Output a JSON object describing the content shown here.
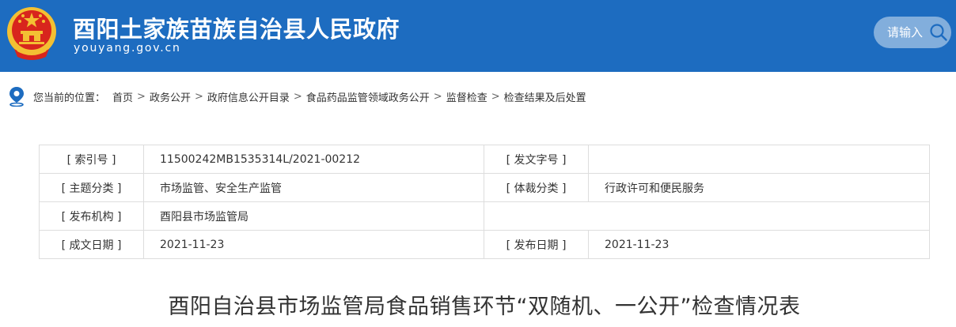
{
  "header": {
    "title": "酉阳土家族苗族自治县人民政府",
    "domain": "youyang.gov.cn",
    "search_placeholder": "请输入",
    "emblem_icon": "national-emblem-icon",
    "search_icon": "search-icon",
    "colors": {
      "bar": "#1d6cc0",
      "emblem_red": "#d8251d",
      "emblem_gold": "#f3c033"
    }
  },
  "breadcrumb": {
    "icon": "location-pin-icon",
    "prefix": "您当前的位置：",
    "items": [
      "首页",
      "政务公开",
      "政府信息公开目录",
      "食品药品监管领域政务公开",
      "监督检查",
      "检查结果及后处置"
    ],
    "separator": ">"
  },
  "meta": {
    "rows": [
      {
        "label1": "[ 索引号 ]",
        "value1": "11500242MB1535314L/2021-00212",
        "label2": "[ 发文字号 ]",
        "value2": ""
      },
      {
        "label1": "[ 主题分类 ]",
        "value1": "市场监管、安全生产监管",
        "label2": "[ 体裁分类 ]",
        "value2": "行政许可和便民服务"
      },
      {
        "label1": "[ 发布机构 ]",
        "value1": "酉阳县市场监管局"
      },
      {
        "label1": "[ 成文日期 ]",
        "value1": "2021-11-23",
        "label2": "[ 发布日期 ]",
        "value2": "2021-11-23"
      }
    ]
  },
  "document": {
    "title": "酉阳自治县市场监管局食品销售环节“双随机、一公开”检查情况表"
  }
}
